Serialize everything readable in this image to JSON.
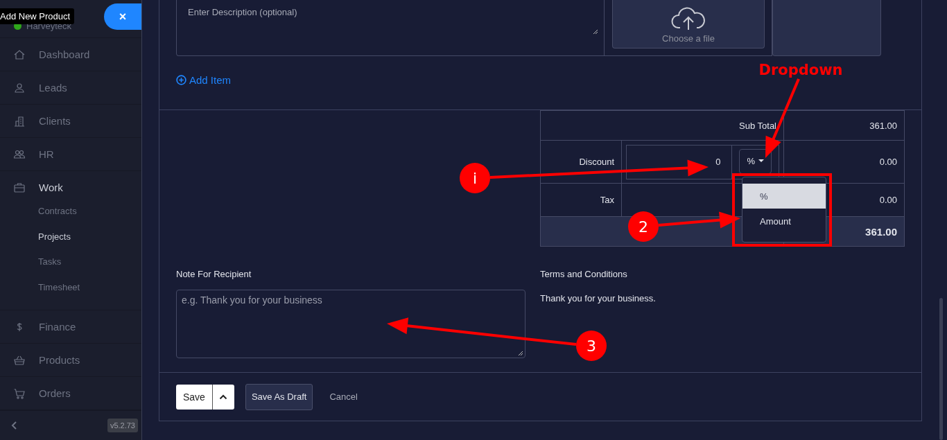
{
  "sidebar": {
    "tooltip": "Add New Product",
    "user": {
      "name": "Harveyteck",
      "online": true
    },
    "close_button": "×",
    "items": [
      {
        "label": "Dashboard",
        "selected": false
      },
      {
        "label": "Leads",
        "selected": false
      },
      {
        "label": "Clients",
        "selected": false
      },
      {
        "label": "HR",
        "selected": false
      },
      {
        "label": "Work",
        "selected": true,
        "children": [
          {
            "label": "Contracts",
            "selected": false
          },
          {
            "label": "Projects",
            "selected": true
          },
          {
            "label": "Tasks",
            "selected": false
          },
          {
            "label": "Timesheet",
            "selected": false
          }
        ]
      },
      {
        "label": "Finance",
        "selected": false
      },
      {
        "label": "Products",
        "selected": false
      },
      {
        "label": "Orders",
        "selected": false
      }
    ],
    "version": "v5.2.73"
  },
  "item": {
    "description_placeholder": "Enter Description (optional)",
    "upload_label": "Choose a file"
  },
  "add_item": "Add Item",
  "totals": {
    "subtotal": {
      "label": "Sub Total",
      "amount": "361.00"
    },
    "discount": {
      "label": "Discount",
      "value": "0",
      "unit": "%",
      "amount": "0.00",
      "menu": [
        {
          "label": "%",
          "selected": true
        },
        {
          "label": "Amount",
          "selected": false
        }
      ]
    },
    "tax": {
      "label": "Tax",
      "amount": "0.00"
    },
    "total": {
      "amount": "361.00"
    }
  },
  "note": {
    "label": "Note For Recipient",
    "placeholder": "e.g. Thank you for your business"
  },
  "terms": {
    "label": "Terms and Conditions",
    "text": "Thank you for your business."
  },
  "actions": {
    "save": "Save",
    "draft": "Save As Draft",
    "cancel": "Cancel"
  },
  "annotations": [
    {
      "kind": "label",
      "text": "Dropdown"
    },
    {
      "kind": "badge",
      "text": "i"
    },
    {
      "kind": "box"
    },
    {
      "kind": "badge",
      "text": "2"
    },
    {
      "kind": "badge",
      "text": "3"
    }
  ]
}
